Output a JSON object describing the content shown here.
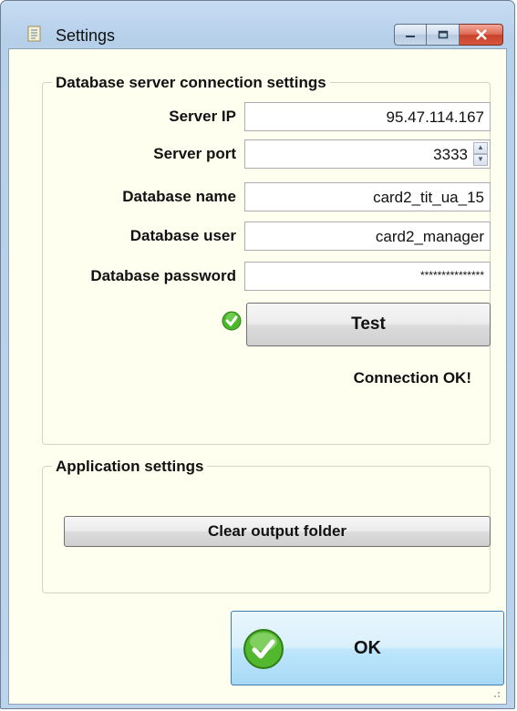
{
  "window": {
    "title": "Settings"
  },
  "db_group": {
    "legend": "Database server connection settings",
    "server_ip_label": "Server IP",
    "server_ip_value": "95.47.114.167",
    "server_port_label": "Server port",
    "server_port_value": "3333",
    "db_name_label": "Database name",
    "db_name_value": "card2_tit_ua_15",
    "db_user_label": "Database user",
    "db_user_value": "card2_manager",
    "db_password_label": "Database password",
    "db_password_value": "***************",
    "test_button": "Test",
    "status": "Connection OK!"
  },
  "app_group": {
    "legend": "Application settings",
    "clear_button": "Clear output folder"
  },
  "ok_button": "OK",
  "colors": {
    "accent_green": "#3aa51f",
    "client_bg": "#fffff0",
    "titlebar": "#bcd3ec"
  }
}
